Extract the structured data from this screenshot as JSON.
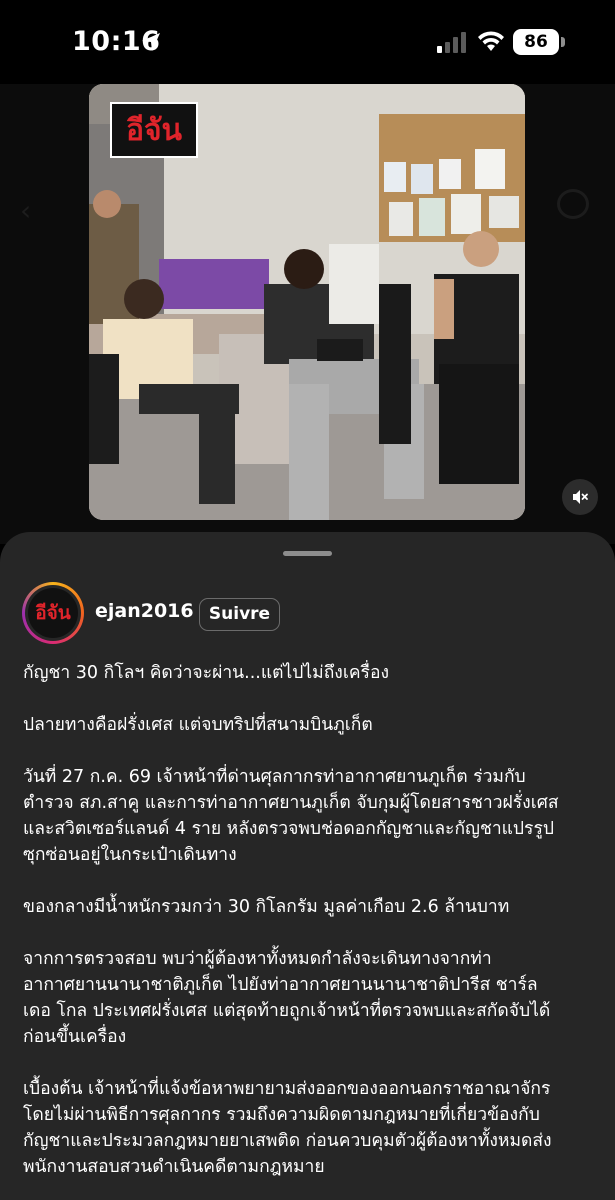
{
  "status_bar": {
    "time": "10:16",
    "battery": "86",
    "icons": [
      "location-arrow-icon",
      "signal-icon",
      "wifi-icon",
      "battery-icon"
    ]
  },
  "post": {
    "logo_text": "อีจัน",
    "mute_icon": "speaker-muted-icon"
  },
  "profile": {
    "username": "ejan2016",
    "avatar_text": "อีจัน",
    "follow_label": "Suivre"
  },
  "caption": {
    "p1": "กัญชา 30 กิโลฯ คิดว่าจะผ่าน...แต่ไปไม่ถึงเครื่อง",
    "p2": "ปลายทางคือฝรั่งเศส แต่จบทริปที่สนามบินภูเก็ต",
    "p3": [
      "วันที่ 27 ก.ค. 69 เจ้าหน้าที่ด่านศุลกากรท่าอากาศยานภูเก็ต ร่วมกับ",
      "ตำรวจ สภ.สาคู และการท่าอากาศยานภูเก็ต จับกุมผู้โดยสารชาวฝรั่งเศส",
      "และสวิตเซอร์แลนด์ 4 ราย หลังตรวจพบช่อดอกกัญชาและกัญชาแปรรูป",
      "ซุกซ่อนอยู่ในกระเป๋าเดินทาง"
    ],
    "p4": "ของกลางมีน้ำหนักรวมกว่า 30 กิโลกรัม มูลค่าเกือบ 2.6 ล้านบาท",
    "p5": [
      "จากการตรวจสอบ พบว่าผู้ต้องหาทั้งหมดกำลังจะเดินทางจากท่า",
      "อากาศยานนานาชาติภูเก็ต ไปยังท่าอากาศยานนานาชาติปารีส ชาร์ล",
      "เดอ โกล ประเทศฝรั่งเศส แต่สุดท้ายถูกเจ้าหน้าที่ตรวจพบและสกัดจับได้",
      "ก่อนขึ้นเครื่อง"
    ],
    "p6": [
      "เบื้องต้น เจ้าหน้าที่แจ้งข้อหาพยายามส่งออกของออกนอกราชอาณาจักร",
      "โดยไม่ผ่านพิธีการศุลกากร รวมถึงความผิดตามกฎหมายที่เกี่ยวข้องกับ",
      "กัญชาและประมวลกฎหมายยาเสพติด ก่อนควบคุมตัวผู้ต้องหาทั้งหมดส่ง",
      "พนักงานสอบสวนดำเนินคดีตามกฎหมาย"
    ]
  },
  "colors": {
    "background": "#000000",
    "sheet": "#262626",
    "logo_red": "#e0242b",
    "follow_border": "#6b6b6b"
  }
}
